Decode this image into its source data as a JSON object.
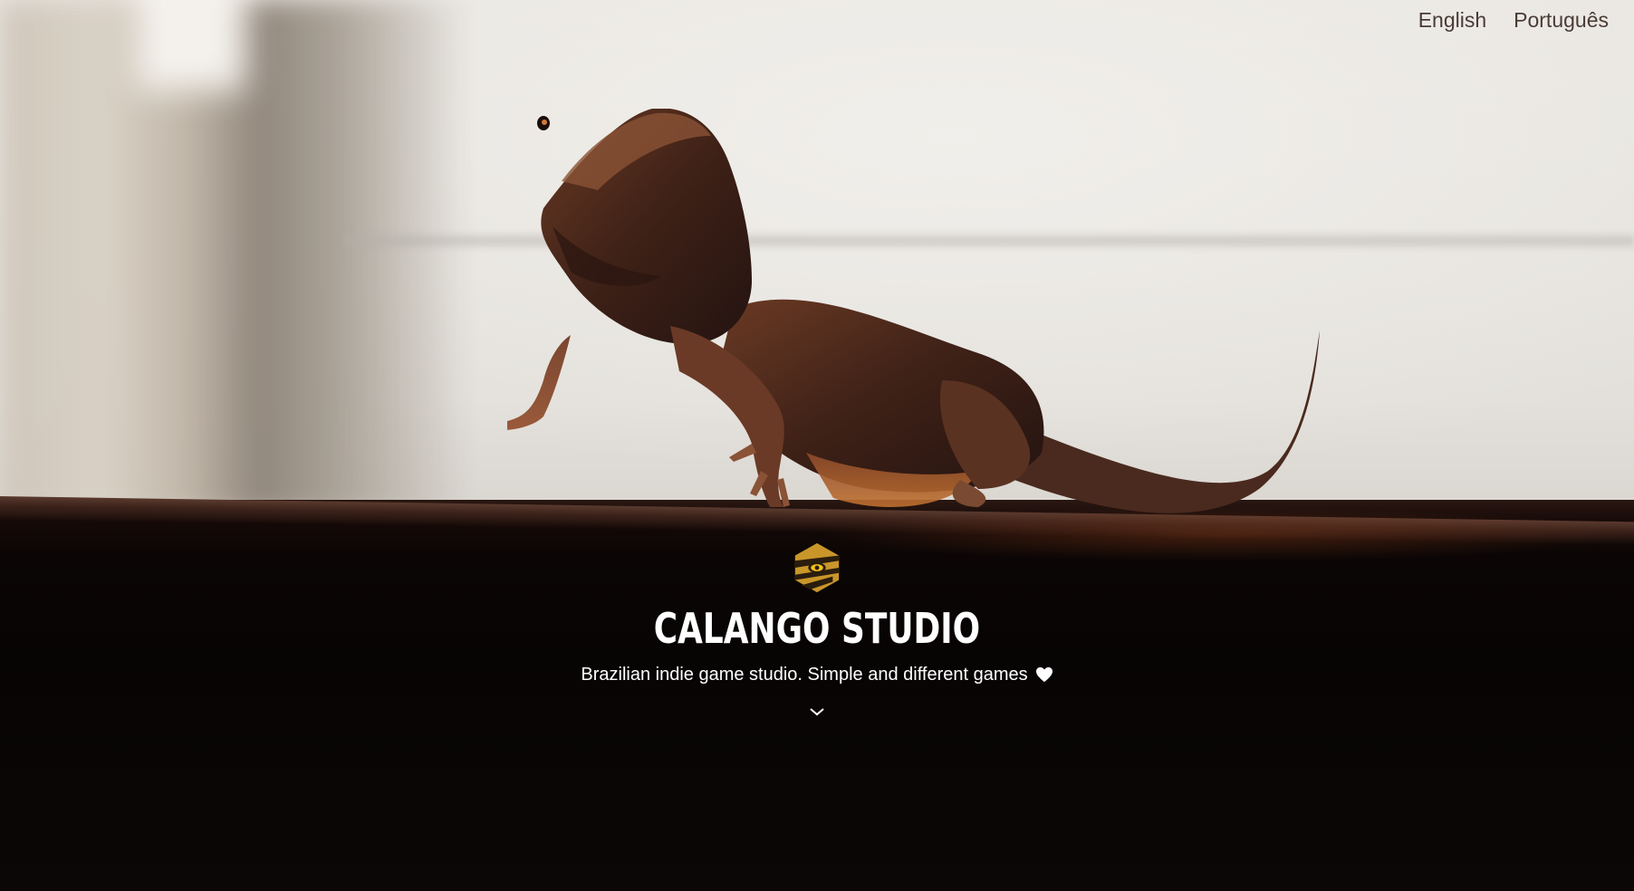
{
  "nav": {
    "languages": [
      {
        "label": "English"
      },
      {
        "label": "Português"
      }
    ]
  },
  "hero": {
    "background_image": "bearded-dragon-lizard-on-ledge",
    "logo_icon": "calango-hexagon-eye-logo",
    "title": "CALANGO STUDIO",
    "subtitle": "Brazilian indie game studio. Simple and different games",
    "heart_icon": "heart-icon",
    "scroll_icon": "chevron-down-icon"
  },
  "colors": {
    "nav_text": "#4a3b35",
    "hero_text": "#ffffff",
    "logo_gold": "#c9962a",
    "logo_dark": "#2a1d0e",
    "logo_eye": "#f2c21b"
  }
}
